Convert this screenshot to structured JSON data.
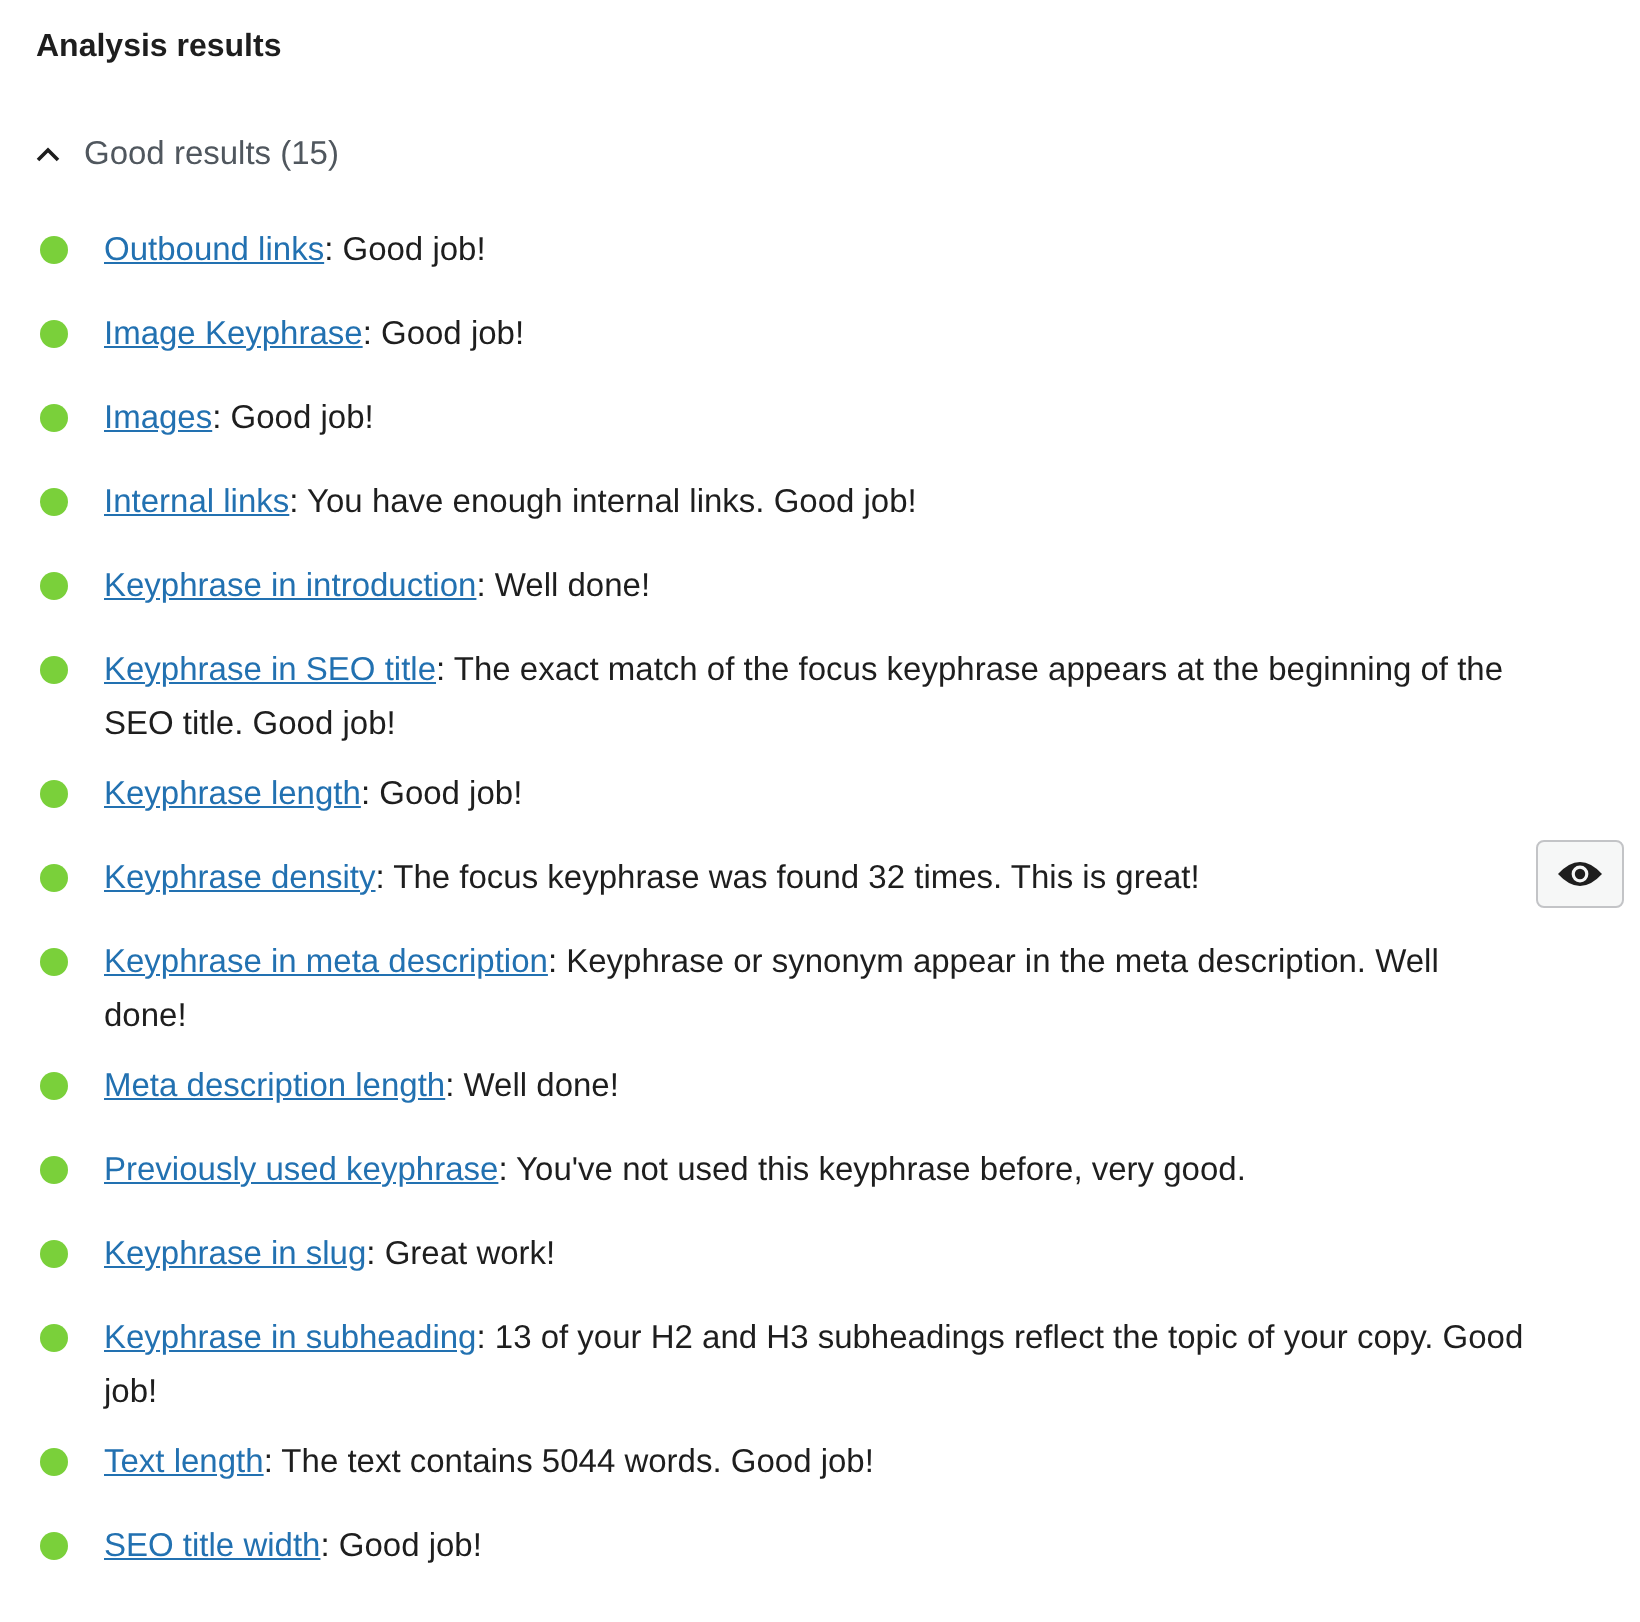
{
  "title": "Analysis results",
  "group": {
    "label": "Good results (15)",
    "expanded": true
  },
  "results": [
    {
      "link": "Outbound links",
      "text": ": Good job!",
      "color": "#7ad03a",
      "eye_button": false
    },
    {
      "link": "Image Keyphrase",
      "text": ": Good job!",
      "color": "#7ad03a",
      "eye_button": false
    },
    {
      "link": "Images",
      "text": ": Good job!",
      "color": "#7ad03a",
      "eye_button": false
    },
    {
      "link": "Internal links",
      "text": ": You have enough internal links. Good job!",
      "color": "#7ad03a",
      "eye_button": false
    },
    {
      "link": "Keyphrase in introduction",
      "text": ": Well done!",
      "color": "#7ad03a",
      "eye_button": false
    },
    {
      "link": "Keyphrase in SEO title",
      "text": ": The exact match of the focus keyphrase appears at the beginning of the SEO title. Good job!",
      "color": "#7ad03a",
      "eye_button": false
    },
    {
      "link": "Keyphrase length",
      "text": ": Good job!",
      "color": "#7ad03a",
      "eye_button": false
    },
    {
      "link": "Keyphrase density",
      "text": ": The focus keyphrase was found 32 times. This is great!",
      "color": "#7ad03a",
      "eye_button": true
    },
    {
      "link": "Keyphrase in meta description",
      "text": ": Keyphrase or synonym appear in the meta description. Well done!",
      "color": "#7ad03a",
      "eye_button": false
    },
    {
      "link": "Meta description length",
      "text": ": Well done!",
      "color": "#7ad03a",
      "eye_button": false
    },
    {
      "link": "Previously used keyphrase",
      "text": ": You've not used this keyphrase before, very good.",
      "color": "#7ad03a",
      "eye_button": false
    },
    {
      "link": "Keyphrase in slug",
      "text": ": Great work!",
      "color": "#7ad03a",
      "eye_button": false
    },
    {
      "link": "Keyphrase in subheading",
      "text": ": 13 of your H2 and H3 subheadings reflect the topic of your copy. Good job!",
      "color": "#7ad03a",
      "eye_button": false
    },
    {
      "link": "Text length",
      "text": ": The text contains 5044 words. Good job!",
      "color": "#7ad03a",
      "eye_button": false
    },
    {
      "link": "SEO title width",
      "text": ": Good job!",
      "color": "#7ad03a",
      "eye_button": false
    }
  ]
}
